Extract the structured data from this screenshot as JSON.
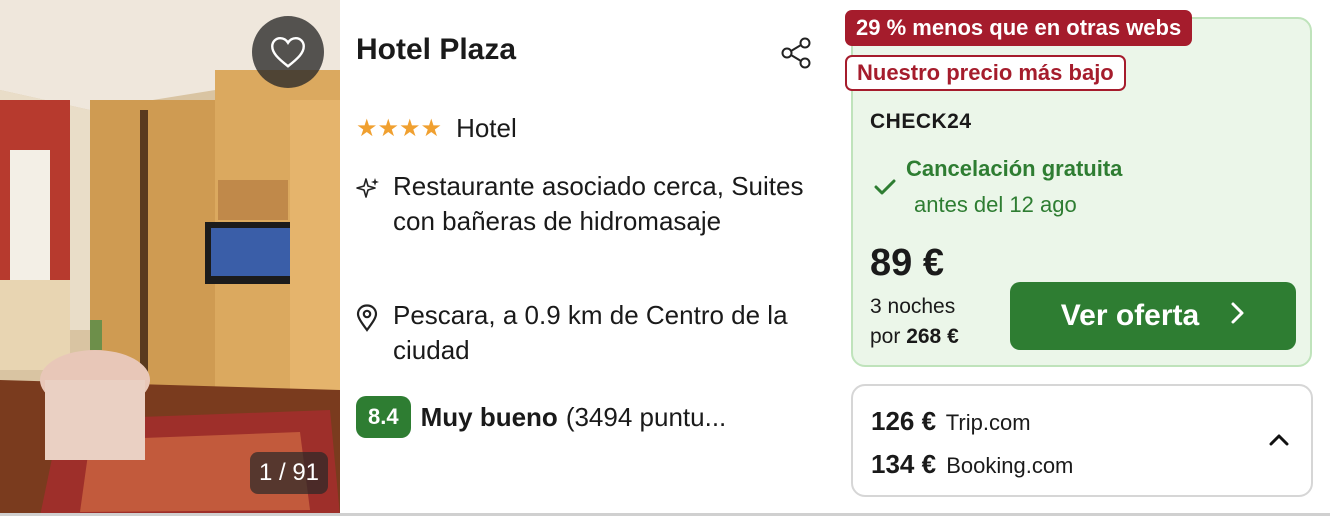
{
  "hotel": {
    "name": "Hotel Plaza",
    "stars": "★★★★",
    "type": "Hotel",
    "features": [
      {
        "icon": "sparkle-icon",
        "text": "Restaurante asociado cerca, Suites con bañeras de hidromasaje"
      },
      {
        "icon": "location-pin-icon",
        "text": "Pescara, a 0.9 km de Centro de la ciudad"
      }
    ],
    "rating": {
      "score": "8.4",
      "label": "Muy bueno",
      "reviews": "(3494 puntu..."
    }
  },
  "gallery": {
    "counter": "1 / 91"
  },
  "deal": {
    "discount_tag": "29 % menos que en otras webs",
    "lowest_tag": "Nuestro precio más bajo",
    "provider": "CHECK24",
    "cancellation": "Cancelación gratuita",
    "cancellation_until": "antes del 12 ago",
    "price": "89 €",
    "nights_label": "3 noches",
    "total_prefix": "por",
    "total": "268 €",
    "cta_label": "Ver oferta"
  },
  "other_offers": [
    {
      "price": "126 €",
      "site": "Trip.com"
    },
    {
      "price": "134 €",
      "site": "Booking.com"
    }
  ],
  "colors": {
    "accent_green": "#2e7d32",
    "deal_red": "#a51c2c",
    "deal_bg": "#ebf6e9",
    "star": "#f0a030"
  }
}
